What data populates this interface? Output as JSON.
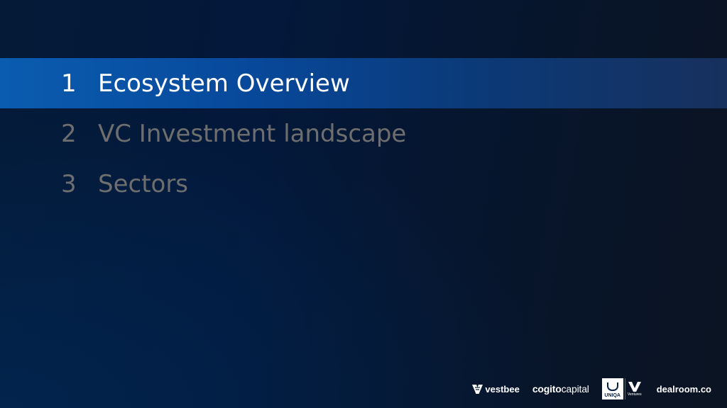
{
  "agenda": {
    "items": [
      {
        "number": "1",
        "label": "Ecosystem Overview",
        "active": true
      },
      {
        "number": "2",
        "label": "VC Investment landscape",
        "active": false
      },
      {
        "number": "3",
        "label": "Sectors",
        "active": false
      }
    ]
  },
  "footer": {
    "logos": {
      "vestbee": {
        "icon": "vestbee-bee-icon",
        "text": "vestbee"
      },
      "cogito": {
        "part1": "cogito",
        "part2": "capital"
      },
      "uniqa": {
        "text": "UNIQA",
        "ventures_text": "Ventures"
      },
      "dealroom": {
        "text": "dealroom.co"
      }
    }
  },
  "colors": {
    "background_dark": "#041a37",
    "active_bar": "#0a5cb0",
    "active_text": "#ffffff",
    "inactive_text": "#6e6e6e"
  }
}
